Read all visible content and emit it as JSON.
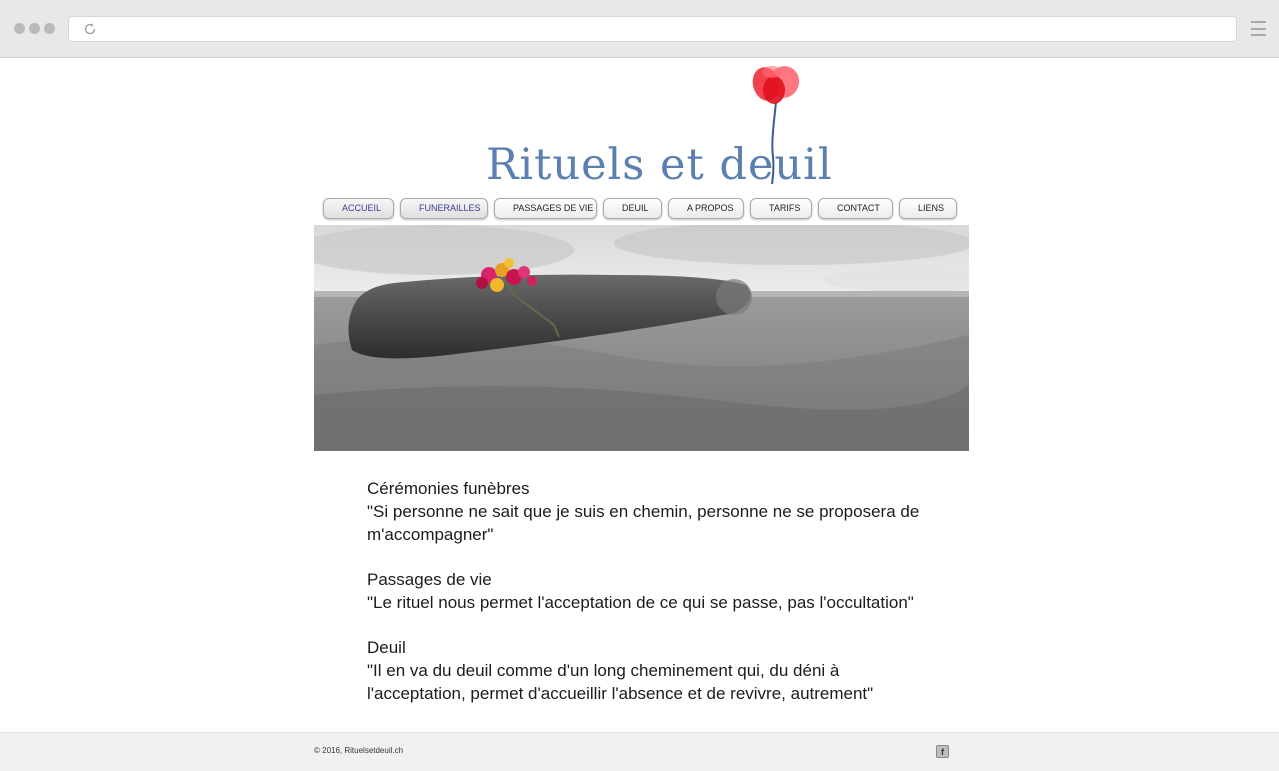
{
  "browser": {
    "reload_icon": "reload-icon",
    "menu_icon": "hamburger-menu-icon"
  },
  "site": {
    "logo_text": "Rituels et deuil",
    "logo_icon": "poppy-flower-icon",
    "accent_color": "#5b7fb0",
    "poppy_color": "#f0202e"
  },
  "nav": {
    "items": [
      {
        "label": "ACCUEIL",
        "active": true
      },
      {
        "label": "FUNERAILLES",
        "active": true
      },
      {
        "label": "PASSAGES DE VIE",
        "active": false
      },
      {
        "label": "DEUIL",
        "active": false
      },
      {
        "label": "A PROPOS",
        "active": false
      },
      {
        "label": "TARIFS",
        "active": false
      },
      {
        "label": "CONTACT",
        "active": false
      },
      {
        "label": "LIENS",
        "active": false
      }
    ]
  },
  "content": {
    "sections": [
      {
        "title": "Cérémonies funèbres",
        "quote": "\"Si personne ne sait que je suis en chemin, personne ne se proposera de m'accompagner\""
      },
      {
        "title": "Passages de vie",
        "quote": "\"Le rituel nous permet l'acceptation de ce qui se passe, pas l'occultation\""
      },
      {
        "title": "Deuil",
        "quote": "\"Il en va du deuil comme d'un long cheminement qui, du déni à l'acceptation, permet d'accueillir l'absence et de revivre, autrement\""
      }
    ]
  },
  "footer": {
    "copyright": "© 2016, Rituelsetdeuil.ch",
    "facebook_label": "f",
    "facebook_icon": "facebook-icon"
  }
}
